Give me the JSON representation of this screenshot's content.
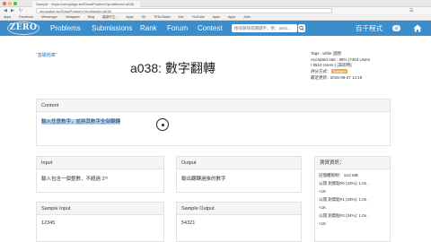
{
  "browser": {
    "tab_title": "Sample · https://zerojudge.tw/ShowProblem?problemid=a038",
    "url": "zerojudge.tw/ShowProblem?problemid=a038",
    "bookmarks": [
      "Apps",
      "Facebook",
      "Messenger",
      "Instagram",
      "Blog",
      "高雄市立...",
      "Apps",
      "Git",
      "TEDxTaipei",
      "Info",
      "YouTube",
      "Apps",
      "Apps",
      "Jobs"
    ]
  },
  "navbar": {
    "logo": "ZERO",
    "links": [
      "Problems",
      "Submissions",
      "Rank",
      "Forum",
      "Contest"
    ],
    "search_placeholder": "搜尋題目或關鍵字，例：a001...",
    "user": "百千程式",
    "badge": "0"
  },
  "problem": {
    "breadcrumb": "\"基礎題庫\"",
    "title": "a038: 數字翻轉",
    "tags": "Tags : while 迴圈",
    "accepted": "Accepted rate : 88% (7463 Users",
    "accepted2": "/ 8510 Users ) [非即時]",
    "rating_label": "評分方式：",
    "rating_badge": "Tolerant",
    "updated": "最近更新 : 2015-08-27 14:19"
  },
  "content": {
    "header": "Content",
    "text": "輸入任意數字，並將其數字全部翻轉"
  },
  "input": {
    "header": "Input",
    "text": "輸入包含一個整數，不超過 2³¹"
  },
  "output": {
    "header": "Output",
    "text": "輸出翻轉過後的數字"
  },
  "sample_input": {
    "header": "Sample Input",
    "text": "12345"
  },
  "sample_output": {
    "header": "Sample Output",
    "text": "54321"
  },
  "info": {
    "header": "測資資訊：",
    "lines": [
      "記憶體限制： 512 MB",
      "公開 測資點#0 (33%): 1.0s ,",
      "<1K",
      "公開 測資點#1 (33%): 1.0s ,",
      "<1K",
      "公開 測資點#2 (34%): 1.0s ,",
      "<1K"
    ]
  }
}
